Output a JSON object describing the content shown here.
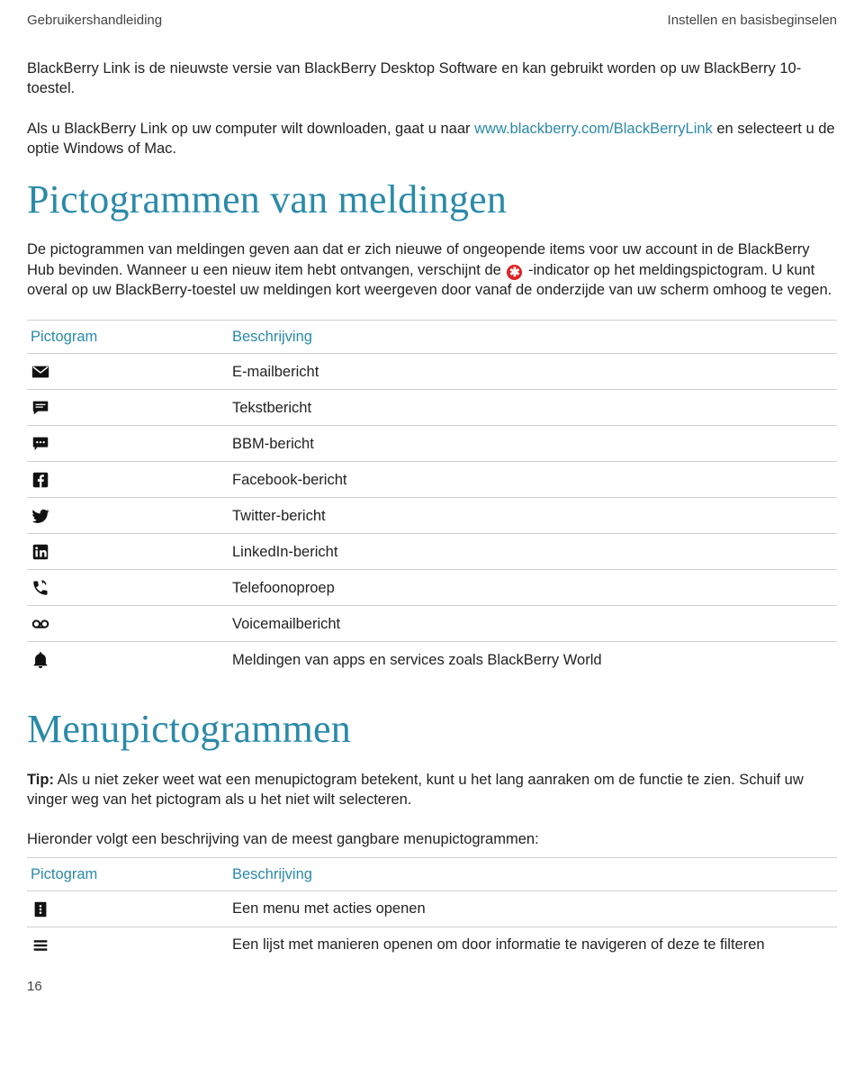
{
  "header": {
    "left": "Gebruikershandleiding",
    "right": "Instellen en basisbeginselen"
  },
  "intro": {
    "p1_a": "BlackBerry Link is de nieuwste versie van BlackBerry Desktop Software en kan gebruikt worden op uw BlackBerry 10-toestel.",
    "p2_a": "Als u BlackBerry Link op uw computer wilt downloaden, gaat u naar ",
    "p2_link": "www.blackberry.com/BlackBerryLink",
    "p2_b": " en selecteert u de optie Windows of Mac."
  },
  "section1": {
    "title": "Pictogrammen van meldingen",
    "desc_a": "De pictogrammen van meldingen geven aan dat er zich nieuwe of ongeopende items voor uw account in de BlackBerry Hub bevinden. Wanneer u een nieuw item hebt ontvangen, verschijnt de ",
    "desc_b": " -indicator op het meldingspictogram. U kunt overal op uw BlackBerry-toestel uw meldingen kort weergeven door vanaf de onderzijde van uw scherm omhoog te vegen.",
    "indicator_glyph": "✱",
    "table": {
      "head_icon": "Pictogram",
      "head_desc": "Beschrijving",
      "rows": [
        {
          "icon": "mail-icon",
          "label": "E-mailbericht"
        },
        {
          "icon": "chat-icon",
          "label": "Tekstbericht"
        },
        {
          "icon": "bbm-icon",
          "label": "BBM-bericht"
        },
        {
          "icon": "facebook-icon",
          "label": "Facebook-bericht"
        },
        {
          "icon": "twitter-icon",
          "label": "Twitter-bericht"
        },
        {
          "icon": "linkedin-icon",
          "label": "LinkedIn-bericht"
        },
        {
          "icon": "phone-icon",
          "label": "Telefoonoproep"
        },
        {
          "icon": "voicemail-icon",
          "label": "Voicemailbericht"
        },
        {
          "icon": "bell-icon",
          "label": "Meldingen van apps en services zoals BlackBerry World"
        }
      ]
    }
  },
  "section2": {
    "title": "Menupictogrammen",
    "tip_label": "Tip:",
    "tip_text": " Als u niet zeker weet wat een menupictogram betekent, kunt u het lang aanraken om de functie te zien. Schuif uw vinger weg van het pictogram als u het niet wilt selecteren.",
    "below": "Hieronder volgt een beschrijving van de meest gangbare menupictogrammen:",
    "table": {
      "head_icon": "Pictogram",
      "head_desc": "Beschrijving",
      "rows": [
        {
          "icon": "overflow-icon",
          "label": "Een menu met acties openen"
        },
        {
          "icon": "list-menu-icon",
          "label": "Een lijst met manieren openen om door informatie te navigeren of deze te filteren"
        }
      ]
    }
  },
  "page_number": "16",
  "icons": {
    "mail-icon": "<svg class='icon-svg' viewBox='0 0 24 24'><rect x='2' y='5' width='20' height='14' rx='1' class='icon-black'/><polyline points='3,6 12,13 21,6' fill='none' stroke='#fff' stroke-width='1.6'/></svg>",
    "chat-icon": "<svg class='icon-svg' viewBox='0 0 24 24'><path class='icon-black' d='M3 4h18v12H9l-5 4V16H3z'/><line x1='6' y1='8' x2='18' y2='8' stroke='#fff' stroke-width='1.4'/><line x1='6' y1='11' x2='15' y2='11' stroke='#fff' stroke-width='1.4'/></svg>",
    "bbm-icon": "<svg class='icon-svg' viewBox='0 0 24 24'><rect x='3' y='4' width='18' height='12' rx='1' class='icon-black'/><path d='M8 16l-3 4v-4z' class='icon-black'/><circle cx='8' cy='10' r='1.3' fill='#fff'/><circle cx='12' cy='10' r='1.3' fill='#fff'/><circle cx='16' cy='10' r='1.3' fill='#fff'/></svg>",
    "facebook-icon": "<svg class='icon-svg' viewBox='0 0 24 24'><rect x='3' y='3' width='18' height='18' rx='2' class='icon-black'/><path d='M13.5 21v-7h2.3l.4-2.7h-2.7V9.5c0-.8.3-1.3 1.4-1.3h1.4V5.8c-.4 0-1.2-.1-2-.1-2.1 0-3.4 1.2-3.4 3.5v1.9H8.6V14h2.3v7h2.6z' fill='#fff'/></svg>",
    "twitter-icon": "<svg class='icon-svg' viewBox='0 0 24 24'><path class='icon-black' d='M22 5.9c-.7.3-1.5.6-2.3.7.8-.5 1.5-1.3 1.8-2.2-.8.5-1.7.8-2.6 1-0.8-.8-1.9-1.3-3.1-1.3-2.3 0-4.2 1.9-4.2 4.2 0 .3 0 .6.1.9C8.2 9 5.1 7.3 3 4.7c-.4.6-.6 1.3-.6 2.1 0 1.5.8 2.8 1.9 3.5-.7 0-1.3-.2-1.9-.5v.1c0 2 1.4 3.7 3.3 4.1-.3.1-.7.1-1.1.1-.3 0-.5 0-.8-.1.5 1.7 2.1 2.9 3.9 2.9-1.4 1.1-3.2 1.8-5.2 1.8H2c1.9 1.2 4.1 1.9 6.5 1.9 7.8 0 12-6.4 12-12v-.5c.8-.6 1.5-1.3 2-2.1z'/></svg>",
    "linkedin-icon": "<svg class='icon-svg' viewBox='0 0 24 24'><rect x='3' y='3' width='18' height='18' rx='2' class='icon-black'/><rect x='6' y='10' width='2.6' height='8' fill='#fff'/><circle cx='7.3' cy='7.3' r='1.5' fill='#fff'/><path d='M11 10h2.5v1.2c.5-.8 1.5-1.4 2.8-1.4 2 0 3 1.3 3 3.6V18h-2.6v-4c0-1-.4-1.7-1.4-1.7-.9 0-1.5.6-1.5 1.7v4H11V10z' fill='#fff'/></svg>",
    "phone-icon": "<svg class='icon-svg' viewBox='0 0 24 24'><path class='icon-black' d='M6.6 10.8c1.3 2.6 3.4 4.7 6 6l2-2c.3-.3.7-.4 1.1-.3 1.1.4 2.3.6 3.5.6.6 0 1 .4 1 1v3.3c0 .6-.4 1-1 1C10.6 20.4 3.6 13.4 3.6 4.8c0-.6.4-1 1-1H8c.6 0 1 .4 1 1 0 1.2.2 2.4.6 3.5.1.4 0 .8-.3 1.1l-1.7 1.4z'/><path class='icon-black' d='M14 3l2 2-2 2'/><path fill='none' stroke='#111' stroke-width='1.6' d='M13.5 3.2c2.5.3 4.5 2.3 4.8 4.8'/></svg>",
    "voicemail-icon": "<svg class='icon-svg' viewBox='0 0 24 24'><circle cx='7' cy='12' r='4' fill='none' stroke='#111' stroke-width='2.2'/><circle cx='17' cy='12' r='4' fill='none' stroke='#111' stroke-width='2.2'/><line x1='7' y1='16' x2='17' y2='16' stroke='#111' stroke-width='2.2'/></svg>",
    "bell-icon": "<svg class='icon-svg' viewBox='0 0 24 24'><path class='icon-black' d='M12 22c1.3 0 2.3-1 2.3-2.3H9.7C9.7 21 10.7 22 12 22zM18.5 16.5V11c0-3.1-2-5.7-5-6.3V4c0-.8-.7-1.5-1.5-1.5S10.5 3.2 10.5 4v.7c-3 .6-5 3.2-5 6.3v5.5L4 18v1h16v-1l-1.5-1.5z'/></svg>",
    "overflow-icon": "<svg class='icon-svg' viewBox='0 0 24 24'><rect x='5' y='3' width='14' height='18' rx='1' class='icon-black'/><circle cx='12' cy='8' r='1.4' fill='#fff'/><circle cx='12' cy='12' r='1.4' fill='#fff'/><circle cx='12' cy='16' r='1.4' fill='#fff'/></svg>",
    "list-menu-icon": "<svg class='icon-svg' viewBox='0 0 24 24'><line x1='4' y1='7'  x2='20' y2='7'  stroke='#111' stroke-width='2.6'/><line x1='4' y1='12' x2='20' y2='12' stroke='#111' stroke-width='2.6'/><line x1='4' y1='17' x2='20' y2='17' stroke='#111' stroke-width='2.6'/></svg>"
  }
}
